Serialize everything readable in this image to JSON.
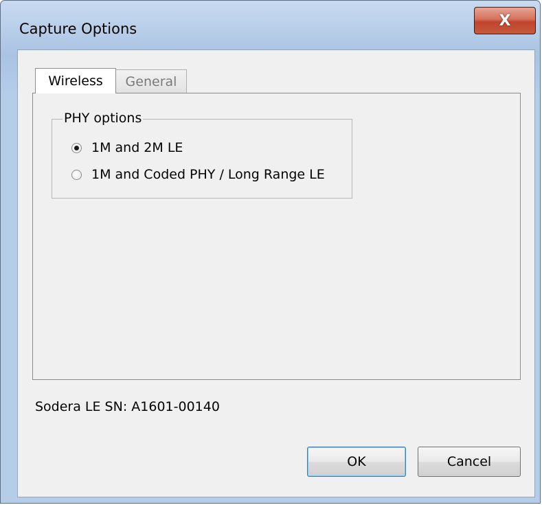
{
  "window": {
    "title": "Capture Options",
    "close_label": "X"
  },
  "tabs": [
    {
      "label": "Wireless",
      "active": true
    },
    {
      "label": "General",
      "active": false
    }
  ],
  "phy_options": {
    "group_label": "PHY options",
    "options": [
      {
        "label": "1M and 2M LE",
        "selected": true
      },
      {
        "label": "1M and Coded PHY / Long Range LE",
        "selected": false
      }
    ]
  },
  "serial_text": "Sodera LE SN: A1601-00140",
  "buttons": {
    "ok_label": "OK",
    "cancel_label": "Cancel"
  },
  "colors": {
    "title_bar": "#b9cfe9",
    "close_button": "#c65a3e",
    "dialog_background": "#f0f0f0"
  }
}
